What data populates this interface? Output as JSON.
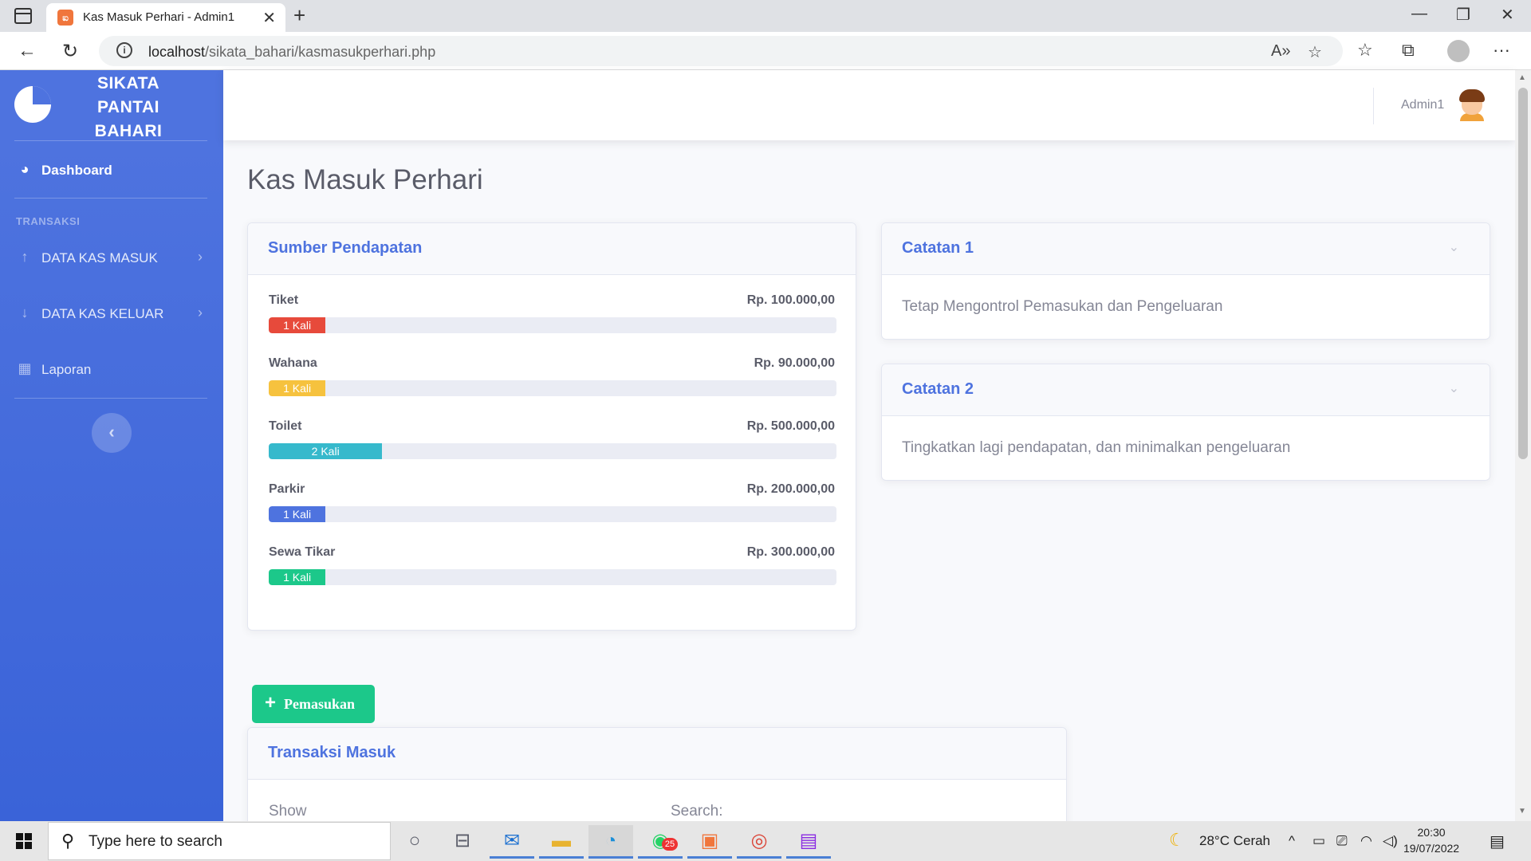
{
  "browser": {
    "tab_title": "Kas Masuk Perhari - Admin1",
    "url_host": "localhost",
    "url_path": "/sikata_bahari/kasmasukperhari.php"
  },
  "sidebar": {
    "brand": "SIKATA\nPANTAI\nBAHARI",
    "dashboard_label": "Dashboard",
    "heading": "TRANSAKSI",
    "items": [
      {
        "label": "DATA KAS MASUK",
        "icon": "arrow-up-icon"
      },
      {
        "label": "DATA KAS KELUAR",
        "icon": "arrow-down-icon"
      },
      {
        "label": "Laporan",
        "icon": "table-icon"
      }
    ]
  },
  "topbar": {
    "user_name": "Admin1"
  },
  "page": {
    "title": "Kas Masuk Perhari"
  },
  "sources_card": {
    "title": "Sumber Pendapatan",
    "items": [
      {
        "label": "Tiket",
        "amount": "Rp. 100.000,00",
        "badge": "1 Kali",
        "percent": 10,
        "color": "#e74a3b"
      },
      {
        "label": "Wahana",
        "amount": "Rp. 90.000,00",
        "badge": "1 Kali",
        "percent": 10,
        "color": "#f6c23e"
      },
      {
        "label": "Toilet",
        "amount": "Rp. 500.000,00",
        "badge": "2 Kali",
        "percent": 20,
        "color": "#36b9cc"
      },
      {
        "label": "Parkir",
        "amount": "Rp. 200.000,00",
        "badge": "1 Kali",
        "percent": 10,
        "color": "#4e73df"
      },
      {
        "label": "Sewa Tikar",
        "amount": "Rp. 300.000,00",
        "badge": "1 Kali",
        "percent": 10,
        "color": "#1cc88a"
      }
    ]
  },
  "notes": [
    {
      "title": "Catatan 1",
      "text": "Tetap Mengontrol Pemasukan dan Pengeluaran"
    },
    {
      "title": "Catatan 2",
      "text": "Tingkatkan lagi pendapatan, dan minimalkan pengeluaran"
    }
  ],
  "add_button_label": "Pemasukan",
  "transactions_card": {
    "title": "Transaksi Masuk",
    "show_label": "Show",
    "search_label": "Search:"
  },
  "taskbar": {
    "search_placeholder": "Type here to search",
    "weather": "28°C  Cerah",
    "time": "20:30",
    "date": "19/07/2022",
    "whatsapp_badge": "25"
  }
}
